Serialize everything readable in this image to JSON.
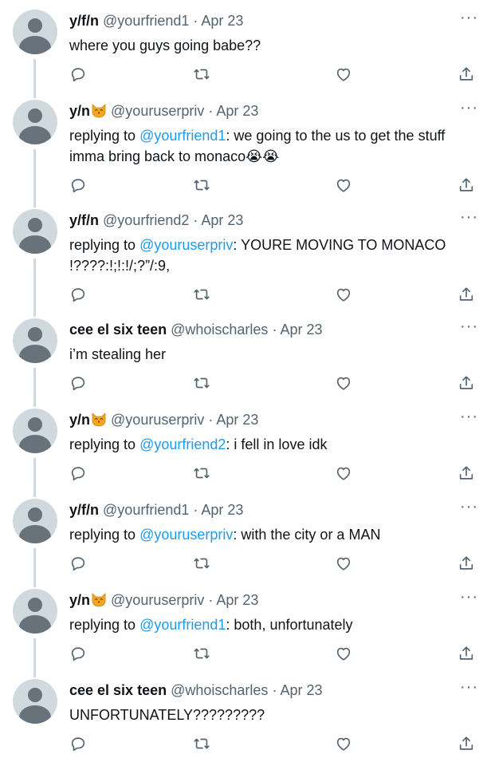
{
  "reply_prefix": "replying to",
  "separator": "·",
  "more_label": "···",
  "accent": "#1d9bf0",
  "tweets": [
    {
      "name": "y/f/n",
      "emoji": false,
      "handle": "@yourfriend1",
      "date": "Apr 23",
      "mention": "",
      "text": "where you guys going babe??"
    },
    {
      "name": "y/n",
      "emoji": true,
      "handle": "@youruserpriv",
      "date": "Apr 23",
      "mention": "@yourfriend1",
      "text": ": we going to the us to get the stuff imma bring back to monaco😭😭"
    },
    {
      "name": "y/f/n",
      "emoji": false,
      "handle": "@yourfriend2",
      "date": "Apr 23",
      "mention": "@youruserpriv",
      "text": ": YOURE MOVING TO MONACO !????:!;!:!/;?”/:9,"
    },
    {
      "name": "cee el six teen",
      "emoji": false,
      "handle": "@whoischarles",
      "date": "Apr 23",
      "mention": "",
      "text": "i’m stealing her"
    },
    {
      "name": "y/n",
      "emoji": true,
      "handle": "@youruserpriv",
      "date": "Apr 23",
      "mention": "@yourfriend2",
      "text": ": i fell in love idk"
    },
    {
      "name": "y/f/n",
      "emoji": false,
      "handle": "@yourfriend1",
      "date": "Apr 23",
      "mention": "@youruserpriv",
      "text": ": with the city or a MAN"
    },
    {
      "name": "y/n",
      "emoji": true,
      "handle": "@youruserpriv",
      "date": "Apr 23",
      "mention": "@yourfriend1",
      "text": ": both, unfortunately"
    },
    {
      "name": "cee el six teen",
      "emoji": false,
      "handle": "@whoischarles",
      "date": "Apr 23",
      "mention": "",
      "text": "UNFORTUNATELY?????????"
    }
  ]
}
